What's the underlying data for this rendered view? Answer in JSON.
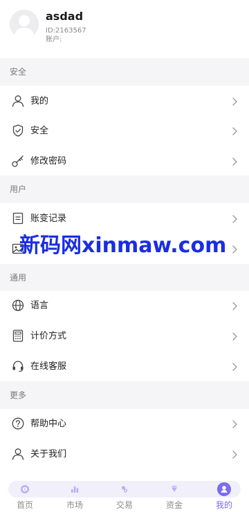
{
  "profile": {
    "username": "asdad",
    "uid": "ID:2163567",
    "account": "账户:"
  },
  "sections": {
    "security": {
      "title": "安全"
    },
    "user": {
      "title": "用户"
    },
    "general": {
      "title": "通用"
    },
    "more": {
      "title": "更多"
    }
  },
  "menu": {
    "mine": {
      "label": "我的",
      "icon": "user-icon"
    },
    "security": {
      "label": "安全",
      "icon": "shield-icon"
    },
    "change_password": {
      "label": "修改密码",
      "icon": "key-icon"
    },
    "account_log": {
      "label": "账变记录",
      "icon": "document-icon"
    },
    "hidden_item": {
      "label": "",
      "icon": "image-icon"
    },
    "language": {
      "label": "语言",
      "icon": "globe-icon"
    },
    "pricing": {
      "label": "计价方式",
      "icon": "calculator-icon"
    },
    "support": {
      "label": "在线客服",
      "icon": "headset-icon"
    },
    "help": {
      "label": "帮助中心",
      "icon": "question-icon"
    },
    "about": {
      "label": "关于我们",
      "icon": "user-icon"
    }
  },
  "watermark": {
    "text": "新码网xinmaw.com"
  },
  "tabbar": {
    "tabs": [
      {
        "label": "首页",
        "icon": "home-icon"
      },
      {
        "label": "市场",
        "icon": "chart-icon"
      },
      {
        "label": "交易",
        "icon": "trade-icon"
      },
      {
        "label": "资金",
        "icon": "diamond-icon"
      },
      {
        "label": "我的",
        "icon": "profile-icon",
        "active": true
      }
    ]
  },
  "colors": {
    "accent": "#7b6cf0",
    "section_bg": "#f5f5f7",
    "watermark": "#1a2ee0"
  }
}
